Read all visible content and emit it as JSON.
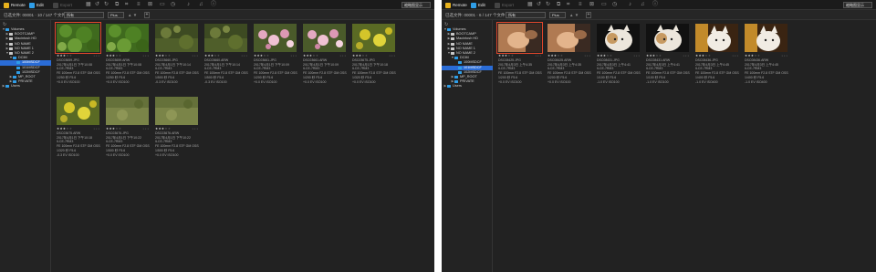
{
  "colors": {
    "bg": "#222222",
    "accent": "#2a6cd6",
    "selection": "#e0462b"
  },
  "windows": [
    {
      "toolbar": {
        "remote_label": "Remote",
        "edit_label": "Edit",
        "export_label": "Export",
        "view_select": "缩略图显示"
      },
      "subbar": {
        "count": "已选文件: 00001 · 10 / 147 个文件",
        "filter": "所有",
        "sort": "Plus",
        "sort_arrows": "▲ ▼",
        "plus": "+"
      },
      "tree": [
        {
          "label": "Volumes",
          "depth": 0,
          "arrow": "▼",
          "icon": "folder"
        },
        {
          "label": "BOOTCAMP",
          "depth": 1,
          "arrow": "▶",
          "icon": "drive"
        },
        {
          "label": "Macintosh HD",
          "depth": 1,
          "arrow": "▶",
          "icon": "drive"
        },
        {
          "label": "NO NAME",
          "depth": 1,
          "arrow": "▶",
          "icon": "drive"
        },
        {
          "label": "NO NAME 1",
          "depth": 1,
          "arrow": "▶",
          "icon": "drive"
        },
        {
          "label": "NO NAME 2",
          "depth": 1,
          "arrow": "▼",
          "icon": "drive"
        },
        {
          "label": "DCIM",
          "depth": 2,
          "arrow": "▼",
          "icon": "folder"
        },
        {
          "label": "100MSDCF",
          "depth": 3,
          "arrow": "",
          "icon": "folder",
          "selected": true
        },
        {
          "label": "101MSDCF",
          "depth": 3,
          "arrow": "",
          "icon": "folder"
        },
        {
          "label": "102MSDCF",
          "depth": 3,
          "arrow": "",
          "icon": "folder"
        },
        {
          "label": "MP_ROOT",
          "depth": 2,
          "arrow": "▶",
          "icon": "folder"
        },
        {
          "label": "PRIVATE",
          "depth": 2,
          "arrow": "▶",
          "icon": "folder"
        },
        {
          "label": "Users",
          "depth": 0,
          "arrow": "▶",
          "icon": "folder"
        }
      ],
      "thumbs": [
        {
          "kind": "moss",
          "selected": true,
          "name": "DSC03659.JPG",
          "date": "2017年4月1日 下午10:08",
          "model": "ILCE-7RM3",
          "lens": "FE 100mm F2.8 STF GM OSS",
          "exp": "1/250 秒 F5.6",
          "ev": "+0.0 EV ISO100"
        },
        {
          "kind": "moss",
          "selected": false,
          "name": "DSC03659.ARW",
          "date": "2017年4月1日 下午10:08",
          "model": "ILCE-7RM3",
          "lens": "FE 100mm F2.8 STF GM OSS",
          "exp": "1/250 秒 F5.6",
          "ev": "+0.0 EV ISO100"
        },
        {
          "kind": "grass",
          "selected": false,
          "name": "DSC03660.JPG",
          "date": "2017年4月1日 下午10:14",
          "model": "ILCE-7RM3",
          "lens": "FE 100mm F2.8 STF GM OSS",
          "exp": "1/500 秒 F5.6",
          "ev": "-0.3 EV ISO100"
        },
        {
          "kind": "grass",
          "selected": false,
          "name": "DSC03660.ARW",
          "date": "2017年4月1日 下午10:14",
          "model": "ILCE-7RM3",
          "lens": "FE 100mm F2.8 STF GM OSS",
          "exp": "1/500 秒 F5.6",
          "ev": "-0.3 EV ISO100"
        },
        {
          "kind": "flowers",
          "selected": false,
          "name": "DSC03661.JPG",
          "date": "2017年4月1日 下午10:09",
          "model": "ILCE-7RM3",
          "lens": "FE 100mm F2.8 STF GM OSS",
          "exp": "1/200 秒 F5.6",
          "ev": "+0.0 EV ISO100"
        },
        {
          "kind": "flowers",
          "selected": false,
          "name": "DSC03661.ARW",
          "date": "2017年4月1日 下午10:09",
          "model": "ILCE-7RM3",
          "lens": "FE 100mm F2.8 STF GM OSS",
          "exp": "1/200 秒 F5.6",
          "ev": "+0.0 EV ISO100"
        },
        {
          "kind": "yellow",
          "selected": false,
          "name": "DSC03675.JPG",
          "date": "2017年4月1日 下午10:18",
          "model": "ILCE-7RM3",
          "lens": "FE 100mm F2.8 STF GM OSS",
          "exp": "1/320 秒 F5.6",
          "ev": "+0.0 EV ISO100"
        },
        {
          "kind": "yellow",
          "selected": false,
          "name": "DSC03675.ARW",
          "date": "2017年4月1日 下午10:18",
          "model": "ILCE-7RM3",
          "lens": "FE 100mm F2.8 STF GM OSS",
          "exp": "1/320 秒 F5.6",
          "ev": "-0.3 EV ISO100"
        },
        {
          "kind": "field",
          "selected": false,
          "name": "DSC03676.JPG",
          "date": "2017年4月1日 下午10:22",
          "model": "ILCE-7RM3",
          "lens": "FE 100mm F2.8 STF GM OSS",
          "exp": "1/500 秒 F5.6",
          "ev": "+0.0 EV ISO100"
        },
        {
          "kind": "field",
          "selected": false,
          "name": "DSC03676.ARW",
          "date": "2017年4月1日 下午10:22",
          "model": "ILCE-7RM3",
          "lens": "FE 100mm F2.8 STF GM OSS",
          "exp": "1/500 秒 F5.6",
          "ev": "+0.0 EV ISO100"
        }
      ]
    },
    {
      "toolbar": {
        "remote_label": "Remote",
        "edit_label": "Edit",
        "export_label": "Export",
        "view_select": "缩略图显示"
      },
      "subbar": {
        "count": "已选文件: 00001 · 6 / 147 个文件",
        "filter": "所有",
        "sort": "Plus",
        "sort_arrows": "▲ ▼",
        "plus": "+"
      },
      "tree": [
        {
          "label": "Volumes",
          "depth": 0,
          "arrow": "▼",
          "icon": "folder"
        },
        {
          "label": "BOOTCAMP",
          "depth": 1,
          "arrow": "▶",
          "icon": "drive"
        },
        {
          "label": "Macintosh HD",
          "depth": 1,
          "arrow": "▶",
          "icon": "drive"
        },
        {
          "label": "NO NAME",
          "depth": 1,
          "arrow": "▶",
          "icon": "drive"
        },
        {
          "label": "NO NAME 1",
          "depth": 1,
          "arrow": "▶",
          "icon": "drive"
        },
        {
          "label": "NO NAME 2",
          "depth": 1,
          "arrow": "▼",
          "icon": "drive"
        },
        {
          "label": "DCIM",
          "depth": 2,
          "arrow": "▼",
          "icon": "folder"
        },
        {
          "label": "100MSDCF",
          "depth": 3,
          "arrow": "",
          "icon": "folder"
        },
        {
          "label": "101MSDCF",
          "depth": 3,
          "arrow": "",
          "icon": "folder",
          "selected": true
        },
        {
          "label": "102MSDCF",
          "depth": 3,
          "arrow": "",
          "icon": "folder"
        },
        {
          "label": "MP_ROOT",
          "depth": 2,
          "arrow": "▶",
          "icon": "folder"
        },
        {
          "label": "PRIVATE",
          "depth": 2,
          "arrow": "▶",
          "icon": "folder"
        },
        {
          "label": "Users",
          "depth": 0,
          "arrow": "▶",
          "icon": "folder"
        }
      ],
      "thumbs": [
        {
          "kind": "hand",
          "selected": true,
          "name": "DSC08425.JPG",
          "date": "2017年4月3日 上午4:35",
          "model": "ILCE-7RM3",
          "lens": "FE 100mm F2.8 STF GM OSS",
          "exp": "1/200 秒 F5.6",
          "ev": "+0.0 EV ISO100"
        },
        {
          "kind": "hand",
          "selected": false,
          "name": "DSC08425.ARW",
          "date": "2017年4月3日 上午4:35",
          "model": "ILCE-7RM3",
          "lens": "FE 100mm F2.8 STF GM OSS",
          "exp": "1/200 秒 F5.6",
          "ev": "+0.0 EV ISO100"
        },
        {
          "kind": "cat",
          "selected": false,
          "name": "DSC08431.JPG",
          "date": "2017年4月3日 上午4:41",
          "model": "ILCE-7RM3",
          "lens": "FE 100mm F2.8 STF GM OSS",
          "exp": "1/100 秒 F5.6",
          "ev": "-1.0 EV ISO100"
        },
        {
          "kind": "cat",
          "selected": false,
          "name": "DSC08431.ARW",
          "date": "2017年4月3日 上午4:41",
          "model": "ILCE-7RM3",
          "lens": "FE 100mm F2.8 STF GM OSS",
          "exp": "1/100 秒 F5.6",
          "ev": "-1.0 EV ISO100"
        },
        {
          "kind": "catwarm",
          "selected": false,
          "name": "DSC08436.JPG",
          "date": "2017年4月3日 上午4:45",
          "model": "ILCE-7RM3",
          "lens": "FE 100mm F2.8 STF GM OSS",
          "exp": "1/400 秒 F5.6",
          "ev": "-1.0 EV ISO400"
        },
        {
          "kind": "catwarm",
          "selected": false,
          "name": "DSC08436.ARW",
          "date": "2017年4月3日 上午4:45",
          "model": "ILCE-7RM3",
          "lens": "FE 100mm F2.8 STF GM OSS",
          "exp": "1/400 秒 F5.6",
          "ev": "-1.0 EV ISO400"
        }
      ]
    }
  ]
}
